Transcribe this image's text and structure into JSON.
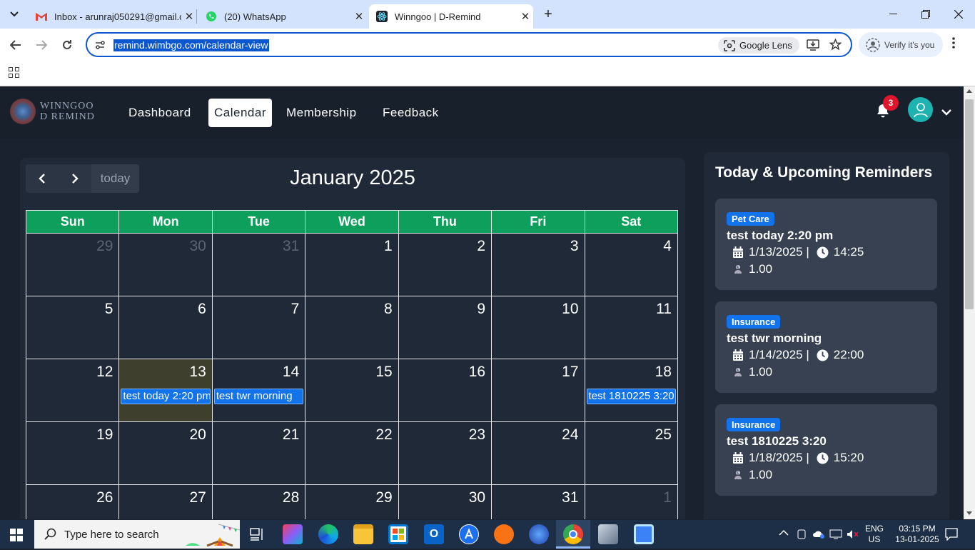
{
  "browser": {
    "tabs": [
      {
        "title": "Inbox - arunraj050291@gmail.c",
        "icon": "gmail-icon"
      },
      {
        "title": "(20) WhatsApp",
        "icon": "whatsapp-icon"
      },
      {
        "title": "Winngoo | D-Remind",
        "icon": "react-icon"
      }
    ],
    "url": "remind.wimbgo.com/calendar-view",
    "lens_label": "Google Lens",
    "verify_label": "Verify it's you"
  },
  "app": {
    "logo_line1": "WINNGOO",
    "logo_line2": "D REMIND",
    "nav": [
      "Dashboard",
      "Calendar",
      "Membership",
      "Feedback"
    ],
    "active_nav": "Calendar",
    "notification_count": "3"
  },
  "calendar": {
    "title": "January 2025",
    "today_label": "today",
    "day_headers": [
      "Sun",
      "Mon",
      "Tue",
      "Wed",
      "Thu",
      "Fri",
      "Sat"
    ],
    "weeks": [
      [
        "29",
        "30",
        "31",
        "1",
        "2",
        "3",
        "4"
      ],
      [
        "5",
        "6",
        "7",
        "8",
        "9",
        "10",
        "11"
      ],
      [
        "12",
        "13",
        "14",
        "15",
        "16",
        "17",
        "18"
      ],
      [
        "19",
        "20",
        "21",
        "22",
        "23",
        "24",
        "25"
      ],
      [
        "26",
        "27",
        "28",
        "29",
        "30",
        "31",
        "1"
      ]
    ],
    "events": {
      "mon13": "test today 2:20 pm",
      "tue14": "test twr morning",
      "sat18": "test 1810225 3:20"
    }
  },
  "reminders": {
    "title": "Today & Upcoming Reminders",
    "items": [
      {
        "tag": "Pet Care",
        "title": "test today 2:20 pm",
        "date": "1/13/2025 |",
        "time": "14:25",
        "amount": "1.00"
      },
      {
        "tag": "Insurance",
        "title": "test twr morning",
        "date": "1/14/2025 |",
        "time": "22:00",
        "amount": "1.00"
      },
      {
        "tag": "Insurance",
        "title": "test 1810225 3:20",
        "date": "1/18/2025 |",
        "time": "15:20",
        "amount": "1.00"
      }
    ]
  },
  "taskbar": {
    "search_placeholder": "Type here to search",
    "lang_line1": "ENG",
    "lang_line2": "US",
    "time": "03:15 PM",
    "date": "13-01-2025"
  }
}
